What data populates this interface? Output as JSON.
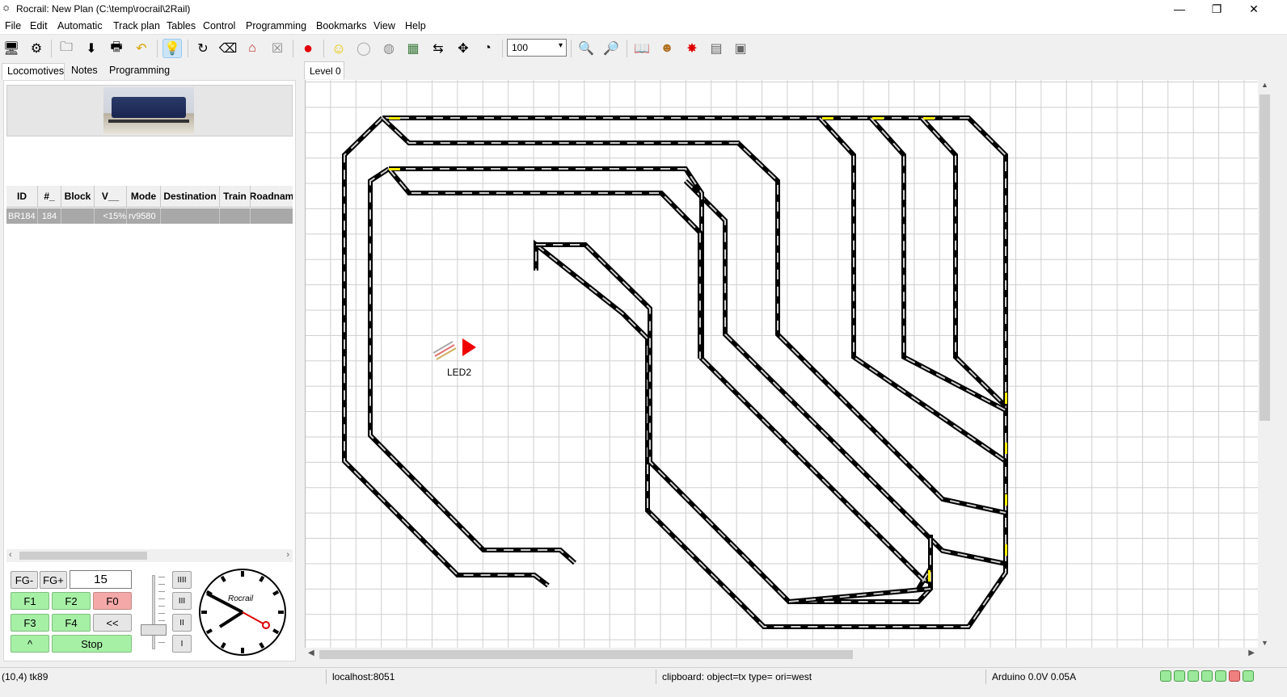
{
  "window": {
    "title": "Rocrail: New Plan (C:\\temp\\rocrail\\2Rail)",
    "minimize": "—",
    "maximize": "❐",
    "close": "✕"
  },
  "menu": [
    "File",
    "Edit",
    "Automatic",
    "Track plan",
    "Tables",
    "Control",
    "Programming",
    "Bookmarks",
    "View",
    "Help"
  ],
  "toolbar": {
    "zoom_value": "100",
    "icons": [
      "connect-icon",
      "settings-icon",
      "open-icon",
      "save-icon",
      "print-icon",
      "undo-icon",
      "lightbulb-icon",
      "loop-icon",
      "eraser-icon",
      "house-icon",
      "close-icon",
      "record-icon",
      "smiley-icon",
      "egg-icon",
      "globe-icon",
      "grid-icon",
      "shuffle-icon",
      "puzzle-icon",
      "speedometer-icon",
      "zoom-in-icon",
      "zoom-out-icon",
      "book-icon",
      "people-icon",
      "alert-icon",
      "document-icon",
      "panel-icon"
    ]
  },
  "left": {
    "tabs": [
      "Locomotives",
      "Notes",
      "Programming"
    ],
    "table": {
      "headers": [
        "ID",
        "#_",
        "Block",
        "V__",
        "Mode",
        "Destination",
        "Train",
        "Roadnam"
      ],
      "rows": [
        [
          "BR184",
          "184",
          "",
          "<15%",
          "rv9580",
          "",
          "",
          ""
        ]
      ]
    },
    "throttle": {
      "fg_minus": "FG-",
      "fg_plus": "FG+",
      "speed": "15",
      "f1": "F1",
      "f2": "F2",
      "f0": "F0",
      "f3": "F3",
      "f4": "F4",
      "reverse": "<<",
      "up": "^",
      "stop": "Stop",
      "steps": [
        "IIII",
        "III",
        "II",
        "I"
      ],
      "clock_brand": "Rocrail"
    }
  },
  "canvas": {
    "level_tab": "Level 0",
    "led_label": "LED2"
  },
  "status": {
    "position": "(10,4) tk89",
    "server": "localhost:8051",
    "clipboard": "clipboard: object=tx type= ori=west",
    "power": "Arduino 0.0V 0.05A"
  },
  "colors": {
    "track": "#000000",
    "sleeper": "#cfcfcf",
    "sensor": "#ffef00",
    "signal": "#ee0000",
    "function_button": "#a6f0a6",
    "function_active": "#f4a8a8"
  }
}
